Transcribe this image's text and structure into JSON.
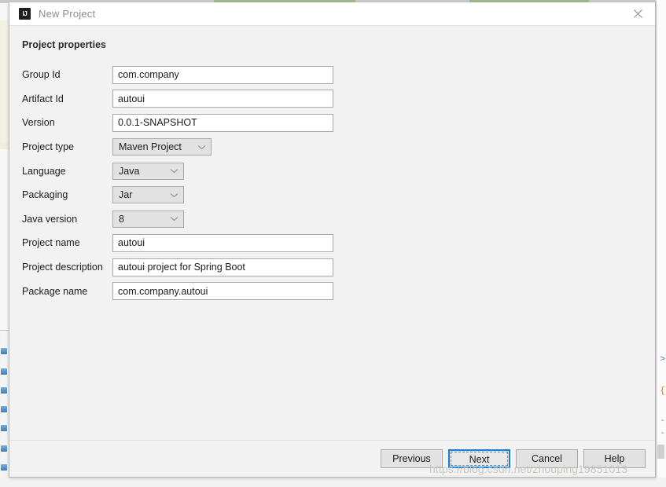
{
  "window": {
    "title": "New Project",
    "logo_icon": "intellij-idea-logo-icon",
    "close_icon": "close-icon"
  },
  "content": {
    "section_heading": "Project properties"
  },
  "form": {
    "rows": [
      {
        "label": "Group Id",
        "type": "text",
        "value": "com.company",
        "placeholder": "",
        "name": "group-id"
      },
      {
        "label": "Artifact Id",
        "type": "text",
        "value": "autoui",
        "placeholder": "",
        "name": "artifact-id"
      },
      {
        "label": "Version",
        "type": "text",
        "value": "0.0.1-SNAPSHOT",
        "placeholder": "",
        "name": "version"
      },
      {
        "label": "Project type",
        "type": "combo",
        "value": "Maven Project",
        "width": "wide",
        "name": "project-type"
      },
      {
        "label": "Language",
        "type": "combo",
        "value": "Java",
        "width": "narrow",
        "name": "language"
      },
      {
        "label": "Packaging",
        "type": "combo",
        "value": "Jar",
        "width": "narrow",
        "name": "packaging"
      },
      {
        "label": "Java version",
        "type": "combo",
        "value": "8",
        "width": "narrow",
        "name": "java-version"
      },
      {
        "label": "Project name",
        "type": "text",
        "value": "autoui",
        "placeholder": "",
        "name": "project-name"
      },
      {
        "label": "Project description",
        "type": "text",
        "value": "autoui project for Spring Boot",
        "placeholder": "",
        "name": "project-description"
      },
      {
        "label": "Package name",
        "type": "text",
        "value": "com.company.autoui",
        "placeholder": "",
        "name": "package-name"
      }
    ]
  },
  "footer": {
    "buttons": [
      {
        "label": "Previous",
        "name": "previous-button",
        "default": false
      },
      {
        "label": "Next",
        "name": "next-button",
        "default": true
      },
      {
        "label": "Cancel",
        "name": "cancel-button",
        "default": false
      },
      {
        "label": "Help",
        "name": "help-button",
        "default": false
      }
    ]
  },
  "overlay": {
    "watermark": "https://blog.csdn.net/zhouping19851013"
  },
  "colors": {
    "accent_focus": "#1a7fd4",
    "dialog_bg": "#f2f2f2",
    "titlebar_bg": "#ffffff",
    "input_bg": "#ffffff",
    "combo_bg": "#e2e2e2",
    "border": "#a9a9a9",
    "text": "#1c1c1c",
    "title_text": "#8c8c8c"
  },
  "background": {
    "right_marks": [
      ">",
      "{",
      "-",
      "-"
    ]
  }
}
